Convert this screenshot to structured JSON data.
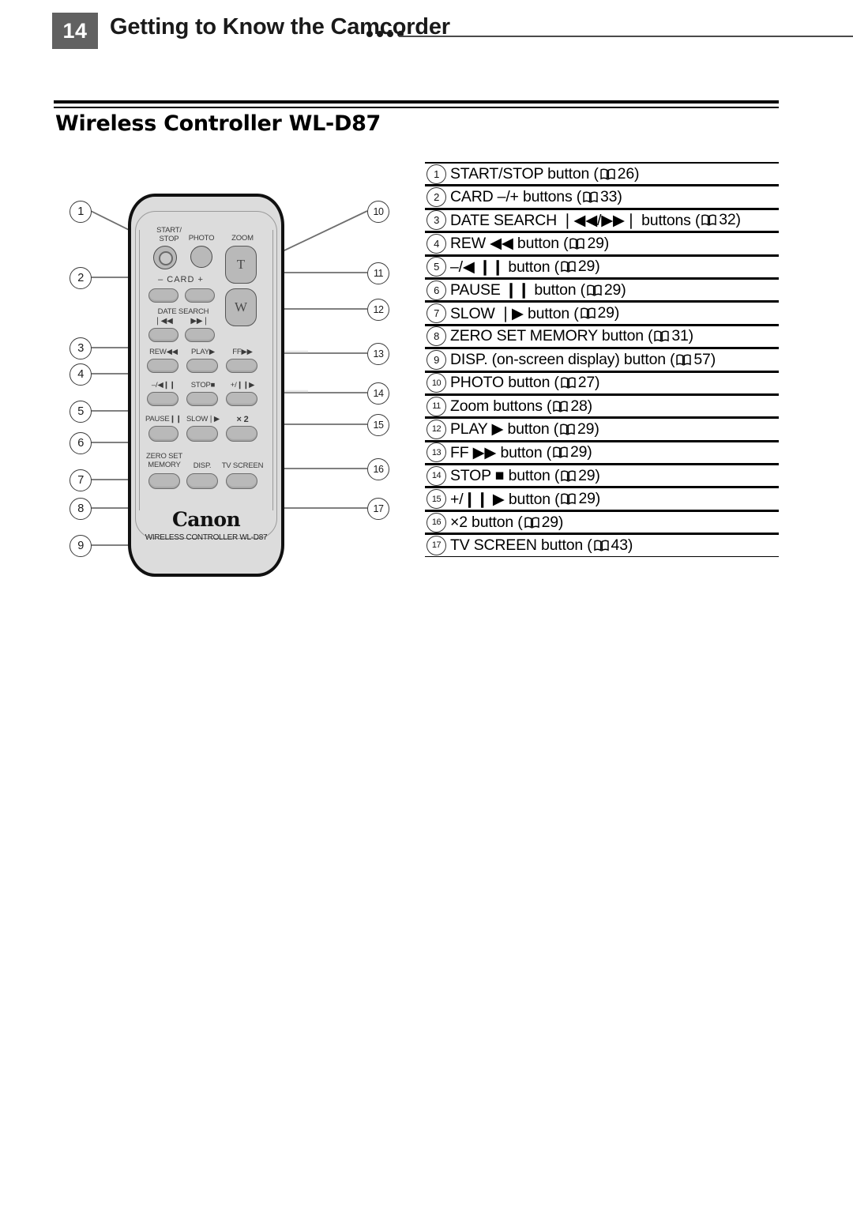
{
  "header": {
    "page_number": "14",
    "title": "Getting to Know the Camcorder",
    "dots_count": 4
  },
  "section": {
    "title": "Wireless Controller WL-D87"
  },
  "figure": {
    "callouts_left": [
      "1",
      "2",
      "3",
      "4",
      "5",
      "6",
      "7",
      "8",
      "9"
    ],
    "callouts_right": [
      "10",
      "11",
      "12",
      "13",
      "14",
      "15",
      "16",
      "17"
    ],
    "remote": {
      "brand": "Canon",
      "model_line": "WIRELESS CONTROLLER WL-D87",
      "labels": {
        "start_stop": "START/\nSTOP",
        "photo": "PHOTO",
        "zoom": "ZOOM",
        "zoom_t": "T",
        "zoom_w": "W",
        "card_minus": "–",
        "card": "CARD",
        "card_plus": "+",
        "date_search": "DATE SEARCH",
        "date_search_prev": "❘◀◀",
        "date_search_next": "▶▶❘",
        "rew": "REW◀◀",
        "play": "PLAY▶",
        "ff": "FF▶▶",
        "minus_frame": "–/◀❙❙",
        "stop": "STOP■",
        "plus_frame": "+/❙❙▶",
        "pause": "PAUSE❙❙",
        "slow": "SLOW❘▶",
        "x2": "× 2",
        "zero_set_memory": "ZERO SET\nMEMORY",
        "disp": "DISP.",
        "tv_screen": "TV SCREEN"
      }
    }
  },
  "legend": {
    "rows": [
      {
        "num": "1",
        "text": "START/STOP button (",
        "page": "26",
        "tail": ")"
      },
      {
        "num": "2",
        "text": "CARD –/+ buttons (",
        "page": "33",
        "tail": ")"
      },
      {
        "num": "3",
        "text": "DATE SEARCH ❘◀◀/▶▶❘ buttons (",
        "page": "32",
        "tail": ")"
      },
      {
        "num": "4",
        "text": "REW ◀◀ button (",
        "page": "29",
        "tail": ")"
      },
      {
        "num": "5",
        "text": "–/◀ ❙❙ button (",
        "page": "29",
        "tail": ")"
      },
      {
        "num": "6",
        "text": "PAUSE ❙❙ button (",
        "page": "29",
        "tail": ")"
      },
      {
        "num": "7",
        "text": "SLOW ❘▶ button (",
        "page": "29",
        "tail": ")"
      },
      {
        "num": "8",
        "text": "ZERO SET MEMORY button (",
        "page": "31",
        "tail": ")"
      },
      {
        "num": "9",
        "text": "DISP. (on-screen display) button (",
        "page": "57",
        "tail": ")"
      },
      {
        "num": "10",
        "text": "PHOTO button (",
        "page": "27",
        "tail": ")"
      },
      {
        "num": "11",
        "text": "Zoom buttons (",
        "page": "28",
        "tail": ")"
      },
      {
        "num": "12",
        "text": "PLAY ▶ button (",
        "page": "29",
        "tail": ")"
      },
      {
        "num": "13",
        "text": "FF ▶▶ button (",
        "page": "29",
        "tail": ")"
      },
      {
        "num": "14",
        "text": "STOP ■ button (",
        "page": "29",
        "tail": ")"
      },
      {
        "num": "15",
        "text": "+/❙❙ ▶ button (",
        "page": "29",
        "tail": ")"
      },
      {
        "num": "16",
        "text": "×2 button (",
        "page": "29",
        "tail": ")"
      },
      {
        "num": "17",
        "text": "TV SCREEN button (",
        "page": "43",
        "tail": ")"
      }
    ]
  },
  "colors": {
    "badge_gray": "#616161",
    "remote_body": "#dcdcdc",
    "button_gray": "#b9b9b9",
    "rule_black": "#000000"
  }
}
